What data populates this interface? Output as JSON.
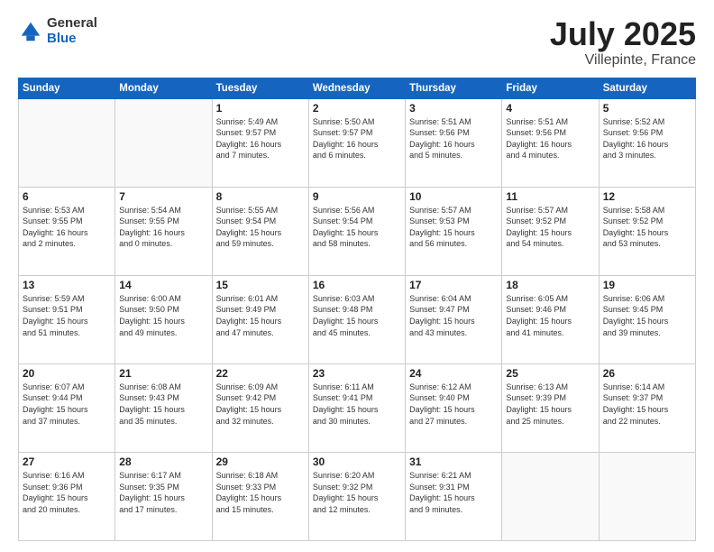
{
  "logo": {
    "general": "General",
    "blue": "Blue"
  },
  "title": {
    "month": "July 2025",
    "location": "Villepinte, France"
  },
  "weekdays": [
    "Sunday",
    "Monday",
    "Tuesday",
    "Wednesday",
    "Thursday",
    "Friday",
    "Saturday"
  ],
  "weeks": [
    [
      {
        "day": "",
        "info": ""
      },
      {
        "day": "",
        "info": ""
      },
      {
        "day": "1",
        "info": "Sunrise: 5:49 AM\nSunset: 9:57 PM\nDaylight: 16 hours\nand 7 minutes."
      },
      {
        "day": "2",
        "info": "Sunrise: 5:50 AM\nSunset: 9:57 PM\nDaylight: 16 hours\nand 6 minutes."
      },
      {
        "day": "3",
        "info": "Sunrise: 5:51 AM\nSunset: 9:56 PM\nDaylight: 16 hours\nand 5 minutes."
      },
      {
        "day": "4",
        "info": "Sunrise: 5:51 AM\nSunset: 9:56 PM\nDaylight: 16 hours\nand 4 minutes."
      },
      {
        "day": "5",
        "info": "Sunrise: 5:52 AM\nSunset: 9:56 PM\nDaylight: 16 hours\nand 3 minutes."
      }
    ],
    [
      {
        "day": "6",
        "info": "Sunrise: 5:53 AM\nSunset: 9:55 PM\nDaylight: 16 hours\nand 2 minutes."
      },
      {
        "day": "7",
        "info": "Sunrise: 5:54 AM\nSunset: 9:55 PM\nDaylight: 16 hours\nand 0 minutes."
      },
      {
        "day": "8",
        "info": "Sunrise: 5:55 AM\nSunset: 9:54 PM\nDaylight: 15 hours\nand 59 minutes."
      },
      {
        "day": "9",
        "info": "Sunrise: 5:56 AM\nSunset: 9:54 PM\nDaylight: 15 hours\nand 58 minutes."
      },
      {
        "day": "10",
        "info": "Sunrise: 5:57 AM\nSunset: 9:53 PM\nDaylight: 15 hours\nand 56 minutes."
      },
      {
        "day": "11",
        "info": "Sunrise: 5:57 AM\nSunset: 9:52 PM\nDaylight: 15 hours\nand 54 minutes."
      },
      {
        "day": "12",
        "info": "Sunrise: 5:58 AM\nSunset: 9:52 PM\nDaylight: 15 hours\nand 53 minutes."
      }
    ],
    [
      {
        "day": "13",
        "info": "Sunrise: 5:59 AM\nSunset: 9:51 PM\nDaylight: 15 hours\nand 51 minutes."
      },
      {
        "day": "14",
        "info": "Sunrise: 6:00 AM\nSunset: 9:50 PM\nDaylight: 15 hours\nand 49 minutes."
      },
      {
        "day": "15",
        "info": "Sunrise: 6:01 AM\nSunset: 9:49 PM\nDaylight: 15 hours\nand 47 minutes."
      },
      {
        "day": "16",
        "info": "Sunrise: 6:03 AM\nSunset: 9:48 PM\nDaylight: 15 hours\nand 45 minutes."
      },
      {
        "day": "17",
        "info": "Sunrise: 6:04 AM\nSunset: 9:47 PM\nDaylight: 15 hours\nand 43 minutes."
      },
      {
        "day": "18",
        "info": "Sunrise: 6:05 AM\nSunset: 9:46 PM\nDaylight: 15 hours\nand 41 minutes."
      },
      {
        "day": "19",
        "info": "Sunrise: 6:06 AM\nSunset: 9:45 PM\nDaylight: 15 hours\nand 39 minutes."
      }
    ],
    [
      {
        "day": "20",
        "info": "Sunrise: 6:07 AM\nSunset: 9:44 PM\nDaylight: 15 hours\nand 37 minutes."
      },
      {
        "day": "21",
        "info": "Sunrise: 6:08 AM\nSunset: 9:43 PM\nDaylight: 15 hours\nand 35 minutes."
      },
      {
        "day": "22",
        "info": "Sunrise: 6:09 AM\nSunset: 9:42 PM\nDaylight: 15 hours\nand 32 minutes."
      },
      {
        "day": "23",
        "info": "Sunrise: 6:11 AM\nSunset: 9:41 PM\nDaylight: 15 hours\nand 30 minutes."
      },
      {
        "day": "24",
        "info": "Sunrise: 6:12 AM\nSunset: 9:40 PM\nDaylight: 15 hours\nand 27 minutes."
      },
      {
        "day": "25",
        "info": "Sunrise: 6:13 AM\nSunset: 9:39 PM\nDaylight: 15 hours\nand 25 minutes."
      },
      {
        "day": "26",
        "info": "Sunrise: 6:14 AM\nSunset: 9:37 PM\nDaylight: 15 hours\nand 22 minutes."
      }
    ],
    [
      {
        "day": "27",
        "info": "Sunrise: 6:16 AM\nSunset: 9:36 PM\nDaylight: 15 hours\nand 20 minutes."
      },
      {
        "day": "28",
        "info": "Sunrise: 6:17 AM\nSunset: 9:35 PM\nDaylight: 15 hours\nand 17 minutes."
      },
      {
        "day": "29",
        "info": "Sunrise: 6:18 AM\nSunset: 9:33 PM\nDaylight: 15 hours\nand 15 minutes."
      },
      {
        "day": "30",
        "info": "Sunrise: 6:20 AM\nSunset: 9:32 PM\nDaylight: 15 hours\nand 12 minutes."
      },
      {
        "day": "31",
        "info": "Sunrise: 6:21 AM\nSunset: 9:31 PM\nDaylight: 15 hours\nand 9 minutes."
      },
      {
        "day": "",
        "info": ""
      },
      {
        "day": "",
        "info": ""
      }
    ]
  ]
}
